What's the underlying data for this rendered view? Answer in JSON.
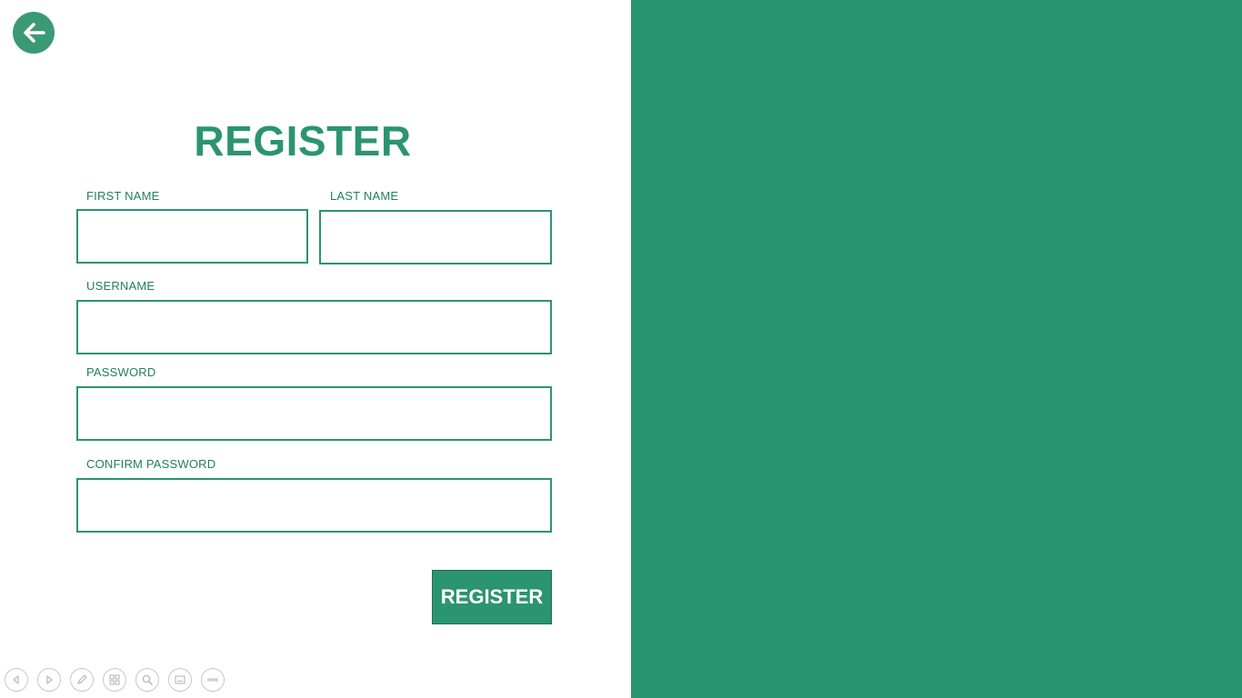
{
  "form": {
    "title": "REGISTER",
    "first_name": {
      "label": "FIRST NAME",
      "value": ""
    },
    "last_name": {
      "label": "LAST NAME",
      "value": ""
    },
    "username": {
      "label": "USERNAME",
      "value": ""
    },
    "password": {
      "label": "PASSWORD",
      "value": ""
    },
    "confirm_password": {
      "label": "CONFIRM PASSWORD",
      "value": ""
    },
    "submit_label": "REGISTER"
  },
  "colors": {
    "accent": "#2b9471",
    "back_button": "#3a9a73",
    "panel_right": "#2b9471"
  },
  "toolbar": {
    "icons": [
      "previous-slide-icon",
      "next-slide-icon",
      "pen-icon",
      "see-all-slides-icon",
      "zoom-icon",
      "subtitles-icon",
      "more-options-icon"
    ]
  }
}
